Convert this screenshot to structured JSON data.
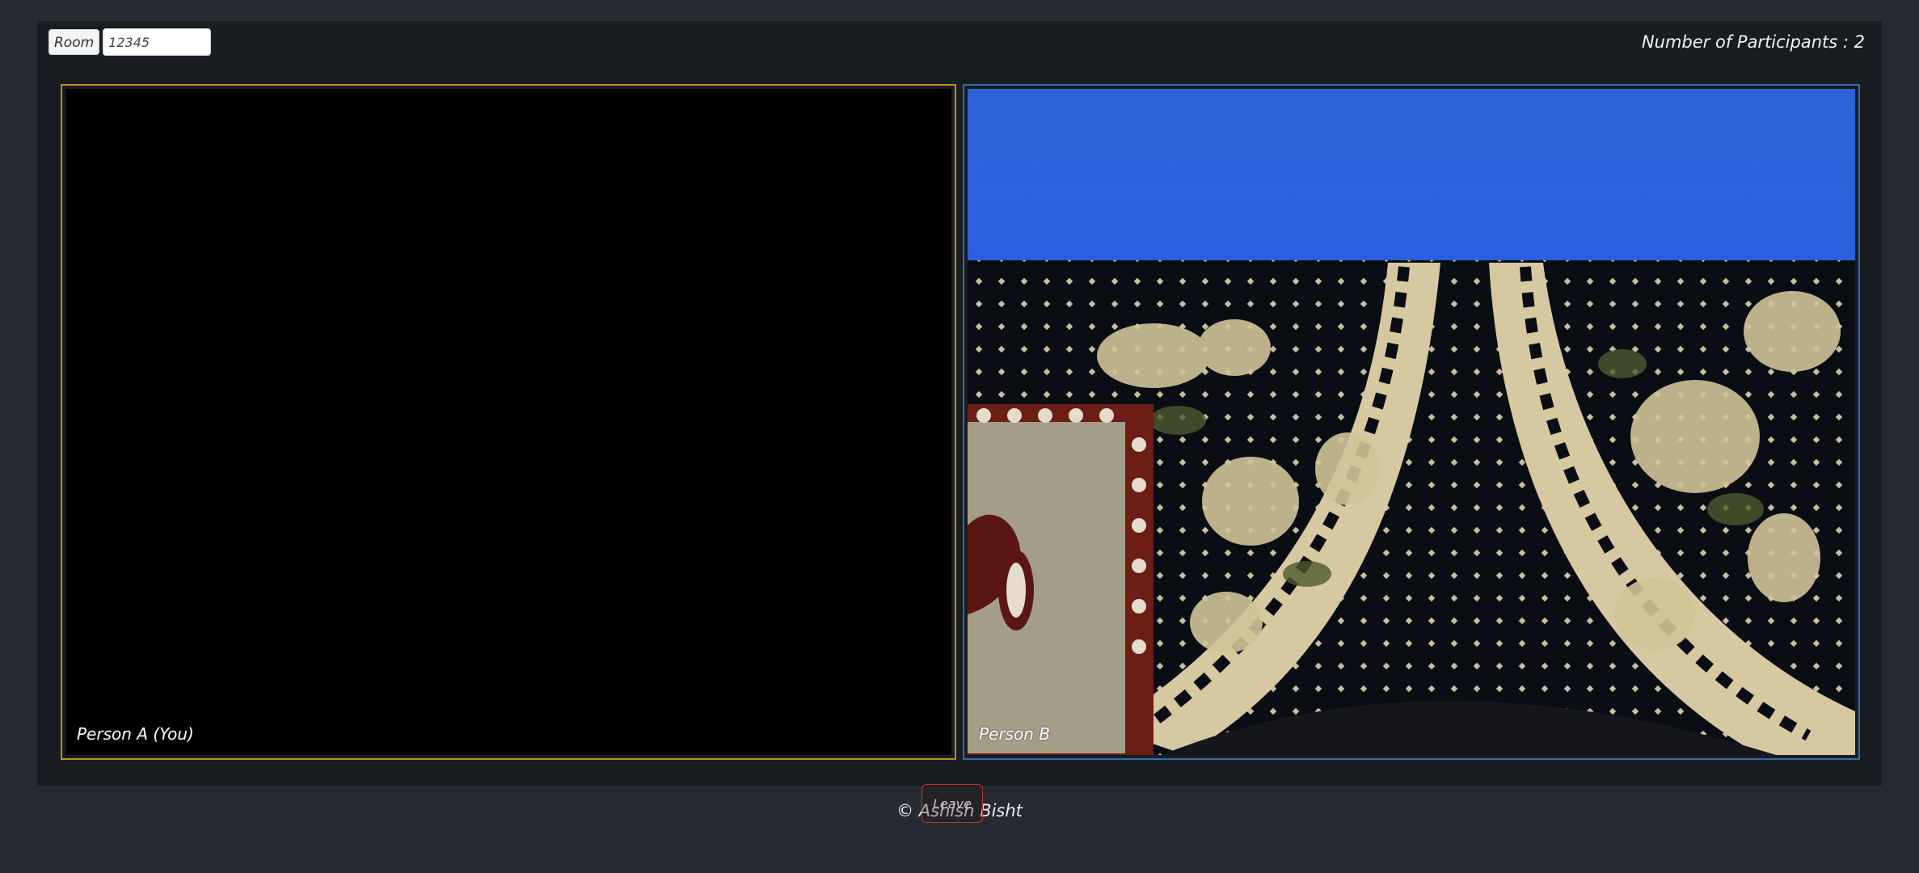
{
  "room": {
    "label": "Room",
    "value": "12345"
  },
  "participants_text": "Number of Participants : 2",
  "videos": [
    {
      "name": "Person A (You)",
      "border_color": "#c18a2a"
    },
    {
      "name": "Person B",
      "border_color": "#2f6da8"
    }
  ],
  "leave_label": "Leave",
  "footer": "© Ashish Bisht",
  "colors": {
    "background": "#262a33",
    "panel": "#191d22",
    "leave_border": "#c0392b"
  }
}
